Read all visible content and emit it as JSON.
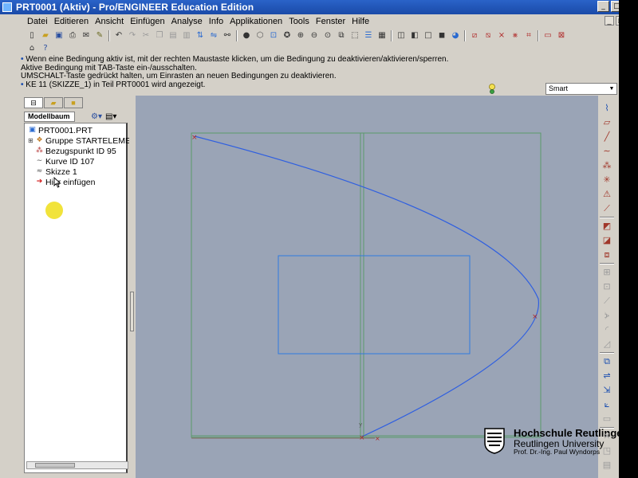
{
  "window": {
    "title": "PRT0001 (Aktiv) - Pro/ENGINEER Education Edition",
    "controls": [
      "_",
      "□",
      "×"
    ]
  },
  "menubar": {
    "items": [
      "Datei",
      "Editieren",
      "Ansicht",
      "Einfügen",
      "Analyse",
      "Info",
      "Applikationen",
      "Tools",
      "Fenster",
      "Hilfe"
    ],
    "window_controls": [
      "_",
      "□",
      "×"
    ]
  },
  "messages": {
    "line1": "Wenn eine Bedingung aktiv ist, mit der rechten Maustaste klicken, um die Bedingung zu deaktivieren/aktivieren/sperren.",
    "line2": "Aktive Bedingung mit TAB-Taste ein-/ausschalten.",
    "line3": "UMSCHALT-Taste gedrückt halten, um Einrasten an neuen Bedingungen zu deaktivieren.",
    "line4": "KE 11 (SKIZZE_1) in Teil PRT0001 wird angezeigt.",
    "bullet": "•"
  },
  "filter": {
    "selected": "Smart"
  },
  "model_tree": {
    "tab_label": "Modellbaum",
    "items": [
      {
        "label": "PRT0001.PRT",
        "icon": "part-icon"
      },
      {
        "label": "Gruppe STARTELEMENT",
        "icon": "group-icon"
      },
      {
        "label": "Bezugspunkt ID 95",
        "icon": "datum-point-icon"
      },
      {
        "label": "Kurve ID 107",
        "icon": "curve-icon"
      },
      {
        "label": "Skizze 1",
        "icon": "sketch-icon"
      },
      {
        "label": "Hier einfügen",
        "icon": "insert-here-arrow-icon"
      }
    ]
  },
  "logo": {
    "line1": "Hochschule Reutlingen",
    "line2": "Reutlingen University",
    "line3": "Prof. Dr.-Ing. Paul Wyndorps"
  },
  "colors": {
    "graphics_background": "#9aa4b6",
    "sketch_curve": "#2f5fe0",
    "frame_lines": "#5a9a6a",
    "title_bar": "#1a4aa8",
    "cursor_highlight": "#f0e12a"
  }
}
